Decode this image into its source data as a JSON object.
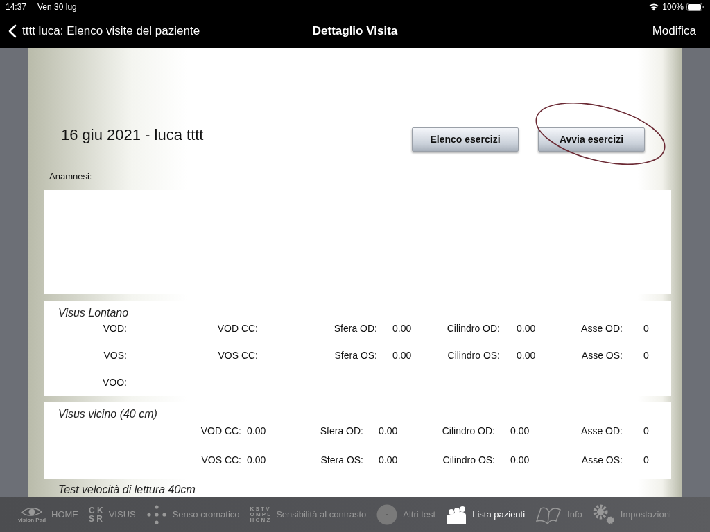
{
  "status_bar": {
    "time": "14:37",
    "date": "Ven 30 lug",
    "battery": "100%"
  },
  "nav_bar": {
    "back": "tttt luca: Elenco visite del paziente",
    "title": "Dettaglio Visita",
    "action": "Modifica"
  },
  "visit": {
    "title": "16 giu 2021 - luca tttt",
    "buttons": [
      {
        "label": "Elenco esercizi",
        "circled": false
      },
      {
        "label": "Avvia esercizi",
        "circled": true
      }
    ],
    "anamnesi_label": "Anamnesi:",
    "sections": [
      {
        "title": "Visus Lontano",
        "rows": [
          {
            "fields": [
              {
                "label": "VOD:"
              },
              {
                "label": "VOD CC:"
              },
              {
                "label": "Sfera OD:",
                "value": "0.00"
              },
              {
                "label": "Cilindro OD:",
                "value": "0.00"
              },
              {
                "label": "Asse OD:",
                "value": "0"
              }
            ]
          },
          {
            "fields": [
              {
                "label": "VOS:"
              },
              {
                "label": "VOS CC:"
              },
              {
                "label": "Sfera OS:",
                "value": "0.00"
              },
              {
                "label": "Cilindro OS:",
                "value": "0.00"
              },
              {
                "label": "Asse OS:",
                "value": "0"
              }
            ]
          },
          {
            "fields": [
              {
                "label": "VOO:"
              }
            ]
          }
        ]
      },
      {
        "title": "Visus vicino (40 cm)",
        "rows": [
          {
            "fields": [
              {
                "label": "VOD CC:",
                "value": "0.00"
              },
              {
                "label": "Sfera OD:",
                "value": "0.00"
              },
              {
                "label": "Cilindro OD:",
                "value": "0.00"
              },
              {
                "label": "Asse OD:",
                "value": "0"
              }
            ]
          },
          {
            "fields": [
              {
                "label": "VOS CC:",
                "value": "0.00"
              },
              {
                "label": "Sfera OS:",
                "value": "0.00"
              },
              {
                "label": "Cilindro OS:",
                "value": "0.00"
              },
              {
                "label": "Asse OS:",
                "value": "0"
              }
            ]
          }
        ]
      }
    ],
    "next_section_title": "Test velocità di lettura 40cm"
  },
  "tab_bar": [
    {
      "kind": "eye-logo",
      "label": "HOME",
      "logo_text": "vision Pad",
      "selected": false
    },
    {
      "kind": "letters",
      "label": "VISUS",
      "icon_rows": [
        "C K",
        "S R"
      ],
      "selected": false
    },
    {
      "kind": "dots",
      "label": "Senso cromatico",
      "selected": false
    },
    {
      "kind": "letters",
      "label": "Sensibilità al contrasto",
      "icon_rows": [
        "K S T V",
        "O M P L",
        "H C N Z"
      ],
      "selected": false
    },
    {
      "kind": "disc",
      "label": "Altri test",
      "selected": false
    },
    {
      "kind": "people",
      "label": "Lista pazienti",
      "selected": true
    },
    {
      "kind": "book",
      "label": "Info",
      "selected": false
    },
    {
      "kind": "gears",
      "label": "Impostazioni",
      "selected": false
    }
  ]
}
